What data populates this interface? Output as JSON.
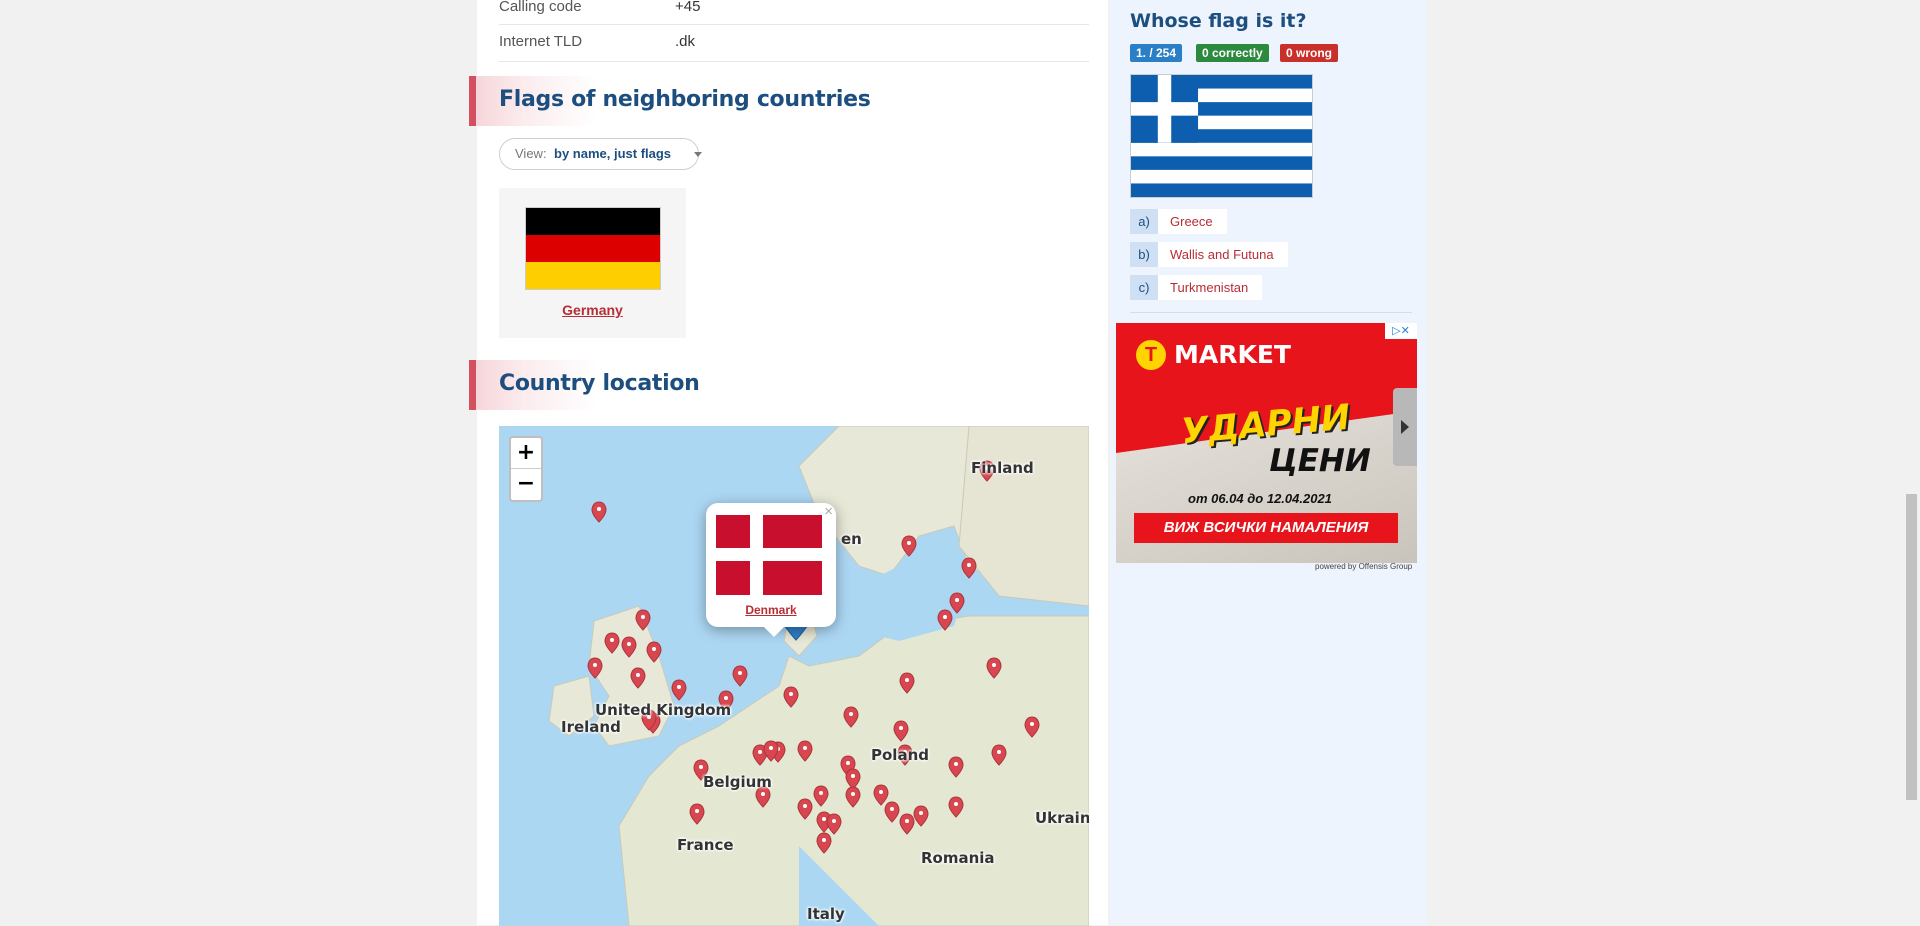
{
  "info": {
    "rows": [
      {
        "key": "Calling code",
        "value": "+45"
      },
      {
        "key": "Internet TLD",
        "value": ".dk"
      }
    ]
  },
  "neighbors": {
    "title": "Flags of neighboring countries",
    "view_label": "View:",
    "view_value": "by name, just flags",
    "flags": [
      {
        "name": "Germany",
        "colors": [
          "#000000",
          "#dd0000",
          "#ffce00"
        ]
      }
    ]
  },
  "location": {
    "title": "Country location",
    "zoom_in": "+",
    "zoom_out": "−",
    "labels": {
      "finland": "Finland",
      "sweden_partial": "en",
      "uk": "United Kingdom",
      "ireland": "Ireland",
      "poland": "Poland",
      "belgium": "Belgium",
      "france": "France",
      "romania": "Romania",
      "ukraine": "Ukrain",
      "italy": "Italy"
    },
    "popup": {
      "country": "Denmark",
      "close": "×"
    },
    "colors": {
      "water": "#acd7f3",
      "land": "#e8e8d8",
      "marker": "#d8474f",
      "active_marker": "#2f7fc6"
    }
  },
  "quiz": {
    "title": "Whose flag is it?",
    "progress": "1. / 254",
    "correct": "0 correctly",
    "wrong": "0 wrong",
    "answers": [
      {
        "letter": "a)",
        "text": "Greece"
      },
      {
        "letter": "b)",
        "text": "Wallis and Futuna"
      },
      {
        "letter": "c)",
        "text": "Turkmenistan"
      }
    ],
    "colors": {
      "blue": "#2a7fc6",
      "green": "#2b8a3e",
      "red": "#c9302c"
    }
  },
  "ad": {
    "brand": "MARKET",
    "headline": "УДАРНИ",
    "subheadline": "ЦЕНИ",
    "dates": "от 06.04 до 12.04.2021",
    "cta": "ВИЖ ВСИЧКИ НАМАЛЕНИЯ",
    "adchoices": "▷✕",
    "powered": "powered by Offensis Group"
  }
}
